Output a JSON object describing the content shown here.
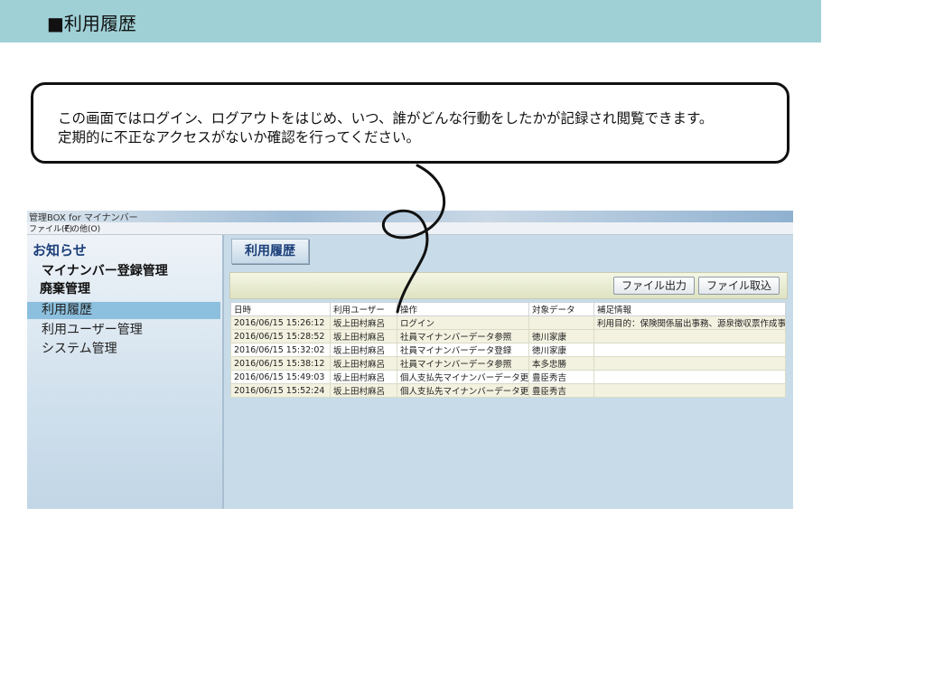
{
  "header": {
    "title": "■利用履歴"
  },
  "bubble": {
    "line1": "この画面ではログイン、ログアウトをはじめ、いつ、誰がどんな行動をしたかが記録され閲覧できます。",
    "line2": "定期的に不正なアクセスがないか確認を行ってください。"
  },
  "window": {
    "title": "管理BOX for マイナンバー",
    "menu": [
      "ファイル(F)",
      "その他(O)"
    ]
  },
  "sidebar": {
    "notice": "お知らせ",
    "items": [
      {
        "label": "マイナンバー登録管理"
      },
      {
        "label": "廃棄管理"
      },
      {
        "label": "利用履歴"
      },
      {
        "label": "利用ユーザー管理"
      },
      {
        "label": "システム管理"
      }
    ]
  },
  "content": {
    "title": "利用履歴",
    "buttons": {
      "export": "ファイル出力",
      "import": "ファイル取込"
    },
    "table": {
      "headers": [
        "日時",
        "利用ユーザー",
        "操作",
        "対象データ",
        "補足情報"
      ],
      "rows": [
        [
          "2016/06/15 15:26:12",
          "坂上田村麻呂",
          "ログイン",
          "",
          "利用目的：保険関係届出事務、源泉徴収票作成事務"
        ],
        [
          "2016/06/15 15:28:52",
          "坂上田村麻呂",
          "社員マイナンバーデータ参照",
          "徳川家康",
          ""
        ],
        [
          "2016/06/15 15:32:02",
          "坂上田村麻呂",
          "社員マイナンバーデータ登録",
          "徳川家康",
          ""
        ],
        [
          "2016/06/15 15:38:12",
          "坂上田村麻呂",
          "社員マイナンバーデータ参照",
          "本多忠勝",
          ""
        ],
        [
          "2016/06/15 15:49:03",
          "坂上田村麻呂",
          "個人支払先マイナンバーデータ更新",
          "豊臣秀吉",
          ""
        ],
        [
          "2016/06/15 15:52:24",
          "坂上田村麻呂",
          "個人支払先マイナンバーデータ更新",
          "豊臣秀吉",
          ""
        ]
      ]
    }
  }
}
